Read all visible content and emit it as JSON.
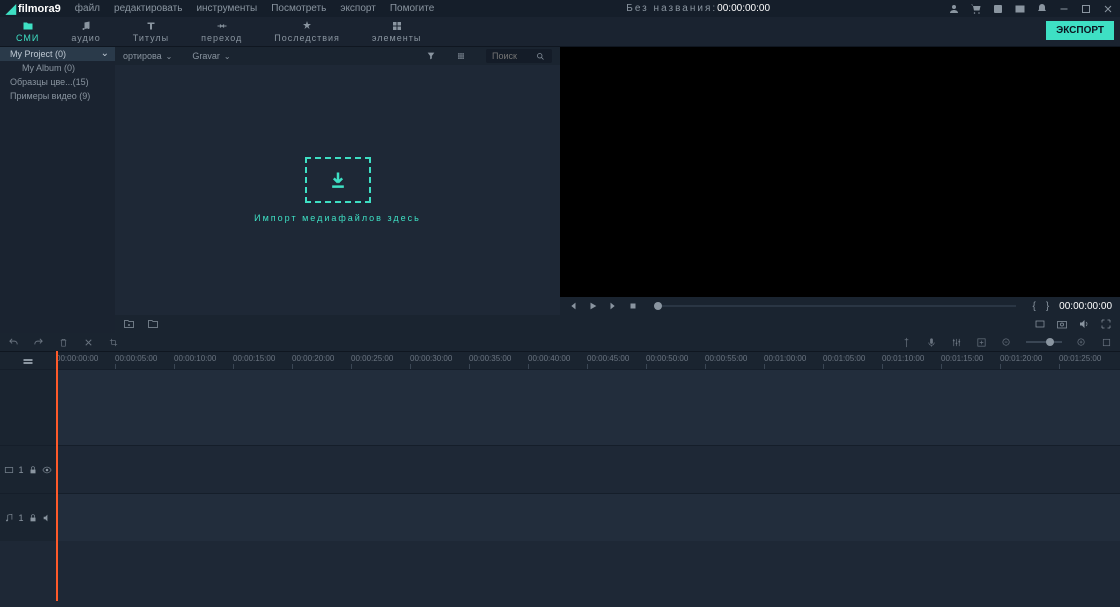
{
  "app": {
    "name": "filmora9"
  },
  "menu": {
    "file": "файл",
    "edit": "редактировать",
    "tools": "инструменты",
    "view": "Посмотреть",
    "export": "экспорт",
    "help": "Помогите"
  },
  "title": {
    "untitled": "Без названия:",
    "time": "00:00:00:00"
  },
  "tabs": {
    "media": "СМИ",
    "audio": "аудио",
    "titles": "Титулы",
    "transition": "переход",
    "effects": "Последствия",
    "elements": "элементы"
  },
  "export_btn": "ЭКСПОРТ",
  "tree": {
    "project": "My Project (0)",
    "album": "My Album (0)",
    "samples": "Образцы цве...(15)",
    "examples": "Примеры видео (9)"
  },
  "media_toolbar": {
    "sort": "ортирова",
    "record": "Gravar"
  },
  "search": {
    "placeholder": "Поиск"
  },
  "dropzone": {
    "text": "Импорт медиафайлов здесь"
  },
  "preview": {
    "time": "00:00:00:00",
    "mark_in": "{",
    "mark_out": "}"
  },
  "timeline": {
    "ticks": [
      "00:00:00:00",
      "00:00:05:00",
      "00:00:10:00",
      "00:00:15:00",
      "00:00:20:00",
      "00:00:25:00",
      "00:00:30:00",
      "00:00:35:00",
      "00:00:40:00",
      "00:00:45:00",
      "00:00:50:00",
      "00:00:55:00",
      "00:01:00:00",
      "00:01:05:00",
      "00:01:10:00",
      "00:01:15:00",
      "00:01:20:00",
      "00:01:25:00"
    ],
    "track1": "1",
    "track2": "1"
  }
}
